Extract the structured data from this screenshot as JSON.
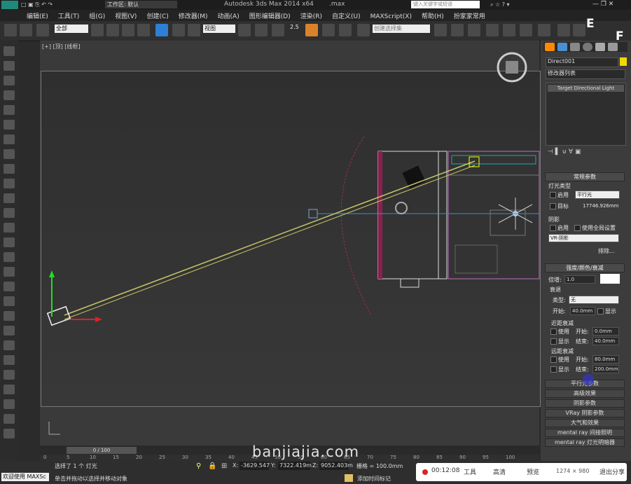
{
  "title": {
    "workspace": "工作区: 默认",
    "app_title": "Autodesk 3ds Max 2014 x64",
    "file_suffix": ".max",
    "search_placeholder": "键入关键字或短语"
  },
  "menu": [
    "编辑(E)",
    "工具(T)",
    "组(G)",
    "视图(V)",
    "创建(C)",
    "修改器(M)",
    "动画(A)",
    "图形编辑器(D)",
    "渲染(R)",
    "自定义(U)",
    "MAXScript(X)",
    "帮助(H)",
    "扮家家常用"
  ],
  "toolbar": {
    "selection_filter": "全部",
    "reference_coord": "视图",
    "snap_value": "2.5",
    "named_selection": "创建选择集"
  },
  "viewport": {
    "label_plus": "[+]",
    "label_view": "[顶]",
    "label_mode": "[线框]"
  },
  "command_panel": {
    "object_name": "Direct001",
    "modifier_list": "修改器列表",
    "stack_item": "Target Directional Light",
    "general_params": {
      "header": "常规参数",
      "light_type_label": "灯光类型",
      "enable_label": "启用",
      "light_type_value": "平行光",
      "target_label": "目标",
      "target_distance": "17746.926mm",
      "shadows_label": "阴影",
      "shadows_enable": "启用",
      "use_global": "使用全局设置",
      "shadow_type": "VR-阴影",
      "exclude": "排除..."
    },
    "intensity": {
      "header": "强度/颜色/衰减",
      "multiplier_label": "倍增:",
      "multiplier_value": "1.0",
      "decay_label": "衰退",
      "type_label": "类型:",
      "type_value": "无",
      "start_label": "开始:",
      "start_value": "40.0mm",
      "show_label": "显示",
      "near_label": "近距衰减",
      "near_use": "使用",
      "near_start_label": "开始:",
      "near_start": "0.0mm",
      "near_show": "显示",
      "near_end_label": "结束:",
      "near_end": "40.0mm",
      "far_label": "远距衰减",
      "far_use": "使用",
      "far_start_label": "开始:",
      "far_start": "80.0mm",
      "far_show": "显示",
      "far_end_label": "结束:",
      "far_end": "200.0mm"
    },
    "rollouts": [
      "平行光参数",
      "高级效果",
      "阴影参数",
      "VRay 阴影参数",
      "大气和效果",
      "mental ray 间接照明",
      "mental ray 灯光明暗器"
    ]
  },
  "timeline": {
    "frame": "0 / 100",
    "ticks": [
      "0",
      "5",
      "10",
      "15",
      "20",
      "25",
      "30",
      "35",
      "40",
      "45",
      "50",
      "55",
      "60",
      "65",
      "70",
      "75",
      "80",
      "85",
      "90",
      "95",
      "100"
    ]
  },
  "status": {
    "welcome": "欢迎使用 MAXSc",
    "selected": "选择了 1 个 灯光",
    "hint": "单击并拖动以选择并移动对象",
    "x_label": "X:",
    "x": "-3629.547",
    "y_label": "Y:",
    "y": "7322.419m",
    "z_label": "Z:",
    "z": "9052.403m",
    "grid": "栅格 = 100.0mm",
    "add_key": "添加时间标记"
  },
  "recorder": {
    "time": "00:12:08",
    "tools": "工具",
    "quality": "高清",
    "preview": "预览",
    "resolution": "1274 × 980",
    "exit": "退出分享"
  },
  "watermark": "banjiajia.com",
  "overlay_letters": [
    "E",
    "F"
  ]
}
